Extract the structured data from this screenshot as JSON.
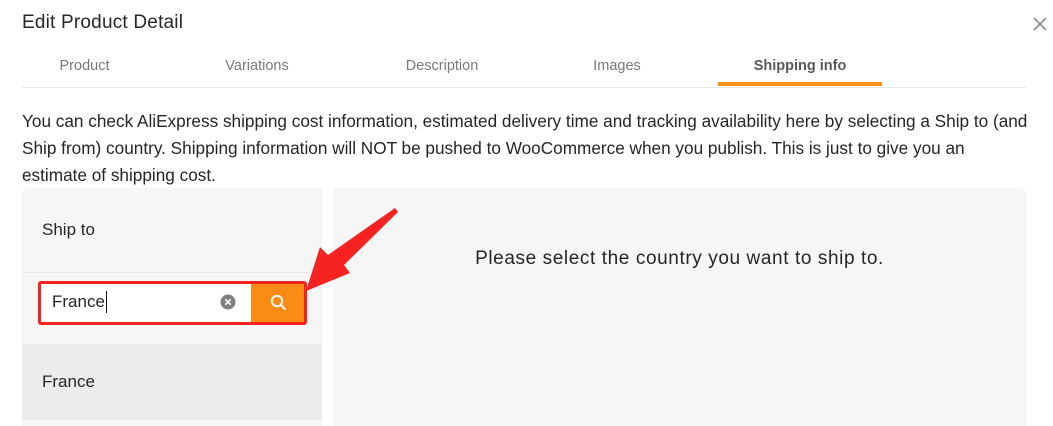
{
  "modal": {
    "title": "Edit Product Detail",
    "close_icon": "close-icon"
  },
  "tabs": [
    {
      "label": "Product",
      "active": false
    },
    {
      "label": "Variations",
      "active": false
    },
    {
      "label": "Description",
      "active": false
    },
    {
      "label": "Images",
      "active": false
    },
    {
      "label": "Shipping info",
      "active": true
    }
  ],
  "notice": "You can check AliExpress shipping cost information, estimated delivery time and tracking availability here by selecting a Ship to (and Ship from) country. Shipping information will NOT be pushed to WooCommerce when you publish. This is just to give you an estimate of shipping cost.",
  "ship_to": {
    "label": "Ship to",
    "search_value": "France",
    "clear_icon": "clear-icon",
    "search_icon": "search-icon",
    "results": [
      "France"
    ]
  },
  "shipping_panel": {
    "message": "Please select the country you want to ship to."
  },
  "colors": {
    "accent": "#fa8c16",
    "tab_ink": "#f7931a",
    "annotation": "#f52222",
    "panel_bg": "#f6f6f6"
  }
}
